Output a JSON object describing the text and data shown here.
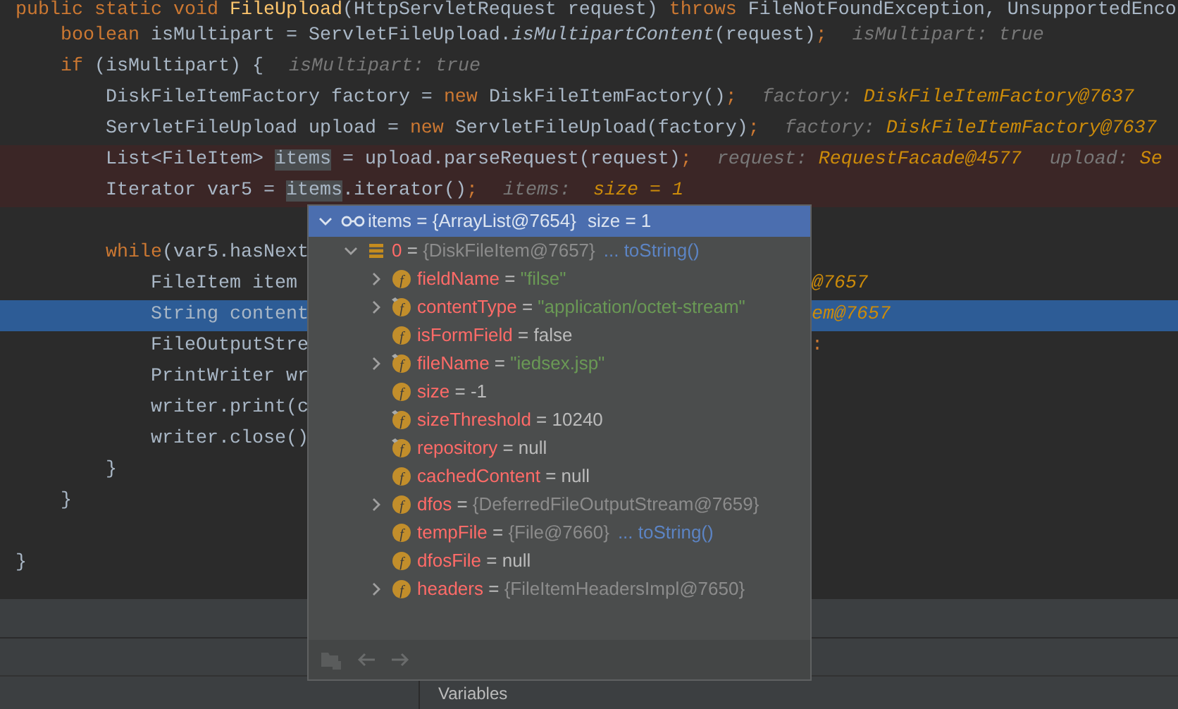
{
  "editor": {
    "lines": [
      {
        "kind": "code",
        "breakpoint": false,
        "selected": false,
        "code": [
          {
            "kind": "kw",
            "text": "public static void "
          },
          {
            "kind": "decl",
            "text": "FileUpload"
          },
          {
            "kind": "p",
            "text": "(HttpServletRequest request) "
          },
          {
            "kind": "kw",
            "text": "throws "
          },
          {
            "kind": "p",
            "text": "FileNotFoundException, UnsupportedEnco"
          }
        ]
      },
      {
        "kind": "code",
        "breakpoint": false,
        "selected": false,
        "code": [
          {
            "kind": "kw",
            "text": "    boolean "
          },
          {
            "kind": "p",
            "text": "isMultipart = ServletFileUpload."
          },
          {
            "kind": "it",
            "text": "isMultipartContent"
          },
          {
            "kind": "p",
            "text": "(request)"
          },
          {
            "kind": "kw",
            "text": ";"
          }
        ],
        "hints": [
          [
            {
              "kind": "hint",
              "text": "isMultipart: true"
            }
          ]
        ]
      },
      {
        "kind": "code",
        "breakpoint": false,
        "selected": false,
        "code": [
          {
            "kind": "kw",
            "text": "    if "
          },
          {
            "kind": "p",
            "text": "(isMultipart) {"
          }
        ],
        "hints": [
          [
            {
              "kind": "hint",
              "text": "isMultipart: true"
            }
          ]
        ]
      },
      {
        "kind": "code",
        "breakpoint": false,
        "selected": false,
        "code": [
          {
            "kind": "p",
            "text": "        DiskFileItemFactory factory = "
          },
          {
            "kind": "kw",
            "text": "new "
          },
          {
            "kind": "p",
            "text": "DiskFileItemFactory()"
          },
          {
            "kind": "kw",
            "text": ";"
          }
        ],
        "hints": [
          [
            {
              "kind": "hint",
              "text": "factory: "
            },
            {
              "kind": "val",
              "text": "DiskFileItemFactory@7637"
            }
          ]
        ]
      },
      {
        "kind": "code",
        "breakpoint": false,
        "selected": false,
        "code": [
          {
            "kind": "p",
            "text": "        ServletFileUpload upload = "
          },
          {
            "kind": "kw",
            "text": "new "
          },
          {
            "kind": "p",
            "text": "ServletFileUpload(factory)"
          },
          {
            "kind": "kw",
            "text": ";"
          }
        ],
        "hints": [
          [
            {
              "kind": "hint",
              "text": "factory: "
            },
            {
              "kind": "val",
              "text": "DiskFileItemFactory@7637"
            }
          ]
        ]
      },
      {
        "kind": "code",
        "breakpoint": true,
        "selected": false,
        "code": [
          {
            "kind": "p",
            "text": "        List<FileItem> "
          },
          {
            "kind": "tok",
            "text": "items"
          },
          {
            "kind": "p",
            "text": " = upload.parseRequest(request)"
          },
          {
            "kind": "kw",
            "text": ";"
          }
        ],
        "hints": [
          [
            {
              "kind": "hint",
              "text": "request: "
            },
            {
              "kind": "val",
              "text": "RequestFacade@4577"
            }
          ],
          [
            {
              "kind": "hint",
              "text": "upload: "
            },
            {
              "kind": "val",
              "text": "Se"
            }
          ]
        ]
      },
      {
        "kind": "code",
        "breakpoint": true,
        "selected": false,
        "code": [
          {
            "kind": "p",
            "text": "        Iterator var5 = "
          },
          {
            "kind": "tok",
            "text": "items"
          },
          {
            "kind": "p",
            "text": ".iterator()"
          },
          {
            "kind": "kw",
            "text": ";"
          }
        ],
        "hints": [
          [
            {
              "kind": "hint",
              "text": "items:  "
            },
            {
              "kind": "val",
              "text": "size = 1"
            }
          ]
        ]
      },
      {
        "kind": "blank"
      },
      {
        "kind": "code",
        "breakpoint": false,
        "selected": false,
        "code": [
          {
            "kind": "kw",
            "text": "        while"
          },
          {
            "kind": "p",
            "text": "(var5.hasNext"
          }
        ]
      },
      {
        "kind": "code",
        "breakpoint": false,
        "selected": false,
        "code": [
          {
            "kind": "p",
            "text": "            FileItem item"
          }
        ],
        "right": [
          {
            "kind": "val",
            "text": "@7657"
          }
        ]
      },
      {
        "kind": "code",
        "breakpoint": false,
        "selected": true,
        "code": [
          {
            "kind": "p",
            "text": "            String content"
          }
        ],
        "right": [
          {
            "kind": "val",
            "text": "em@7657"
          }
        ]
      },
      {
        "kind": "code",
        "breakpoint": false,
        "selected": false,
        "code": [
          {
            "kind": "p",
            "text": "            FileOutputStre"
          }
        ],
        "right": [
          {
            "kind": "kw",
            "text": ":"
          }
        ]
      },
      {
        "kind": "code",
        "breakpoint": false,
        "selected": false,
        "code": [
          {
            "kind": "p",
            "text": "            PrintWriter wr"
          }
        ]
      },
      {
        "kind": "code",
        "breakpoint": false,
        "selected": false,
        "code": [
          {
            "kind": "p",
            "text": "            writer.print(c"
          }
        ]
      },
      {
        "kind": "code",
        "breakpoint": false,
        "selected": false,
        "code": [
          {
            "kind": "p",
            "text": "            writer.close()"
          }
        ]
      },
      {
        "kind": "code",
        "breakpoint": false,
        "selected": false,
        "code": [
          {
            "kind": "p",
            "text": "        }"
          }
        ]
      },
      {
        "kind": "code",
        "breakpoint": false,
        "selected": false,
        "code": [
          {
            "kind": "p",
            "text": "    }"
          }
        ]
      },
      {
        "kind": "blank"
      },
      {
        "kind": "code",
        "breakpoint": false,
        "selected": false,
        "code": [
          {
            "kind": "p",
            "text": "}"
          }
        ]
      }
    ]
  },
  "popup": {
    "root": {
      "name": "items",
      "operator": "=",
      "value": "{ArrayList@7654}",
      "extra": "size = 1",
      "expanded": true,
      "selected": true,
      "children": [
        {
          "name": "0",
          "operator": "=",
          "value": "{DiskFileItem@7657}",
          "link": "... toString()",
          "expanded": true,
          "selected": false,
          "children": [
            {
              "icon": "f",
              "name": "fieldName",
              "operator": "=",
              "value": "\"filse\"",
              "kind": "string",
              "expanded": false,
              "marked": false,
              "selected": false
            },
            {
              "icon": "f",
              "name": "contentType",
              "operator": "=",
              "value": "\"application/octet-stream\"",
              "kind": "string",
              "expanded": false,
              "marked": true,
              "selected": false
            },
            {
              "icon": "f",
              "name": "isFormField",
              "operator": "=",
              "value": "false",
              "kind": "primitive",
              "marked": false,
              "selected": false
            },
            {
              "icon": "f",
              "name": "fileName",
              "operator": "=",
              "value": "\"iedsex.jsp\"",
              "kind": "string",
              "expanded": false,
              "marked": true,
              "selected": false
            },
            {
              "icon": "f",
              "name": "size",
              "operator": "=",
              "value": "-1",
              "kind": "primitive",
              "marked": false,
              "selected": false
            },
            {
              "icon": "f",
              "name": "sizeThreshold",
              "operator": "=",
              "value": "10240",
              "kind": "primitive",
              "marked": true,
              "selected": false
            },
            {
              "icon": "f",
              "name": "repository",
              "operator": "=",
              "value": "null",
              "kind": "primitive",
              "marked": true,
              "selected": false
            },
            {
              "icon": "f",
              "name": "cachedContent",
              "operator": "=",
              "value": "null",
              "kind": "primitive",
              "marked": false,
              "selected": false
            },
            {
              "icon": "f",
              "name": "dfos",
              "operator": "=",
              "value": "{DeferredFileOutputStream@7659}",
              "kind": "ref",
              "expanded": false,
              "marked": false,
              "selected": false
            },
            {
              "icon": "f",
              "name": "tempFile",
              "operator": "=",
              "value": "{File@7660}",
              "kind": "ref",
              "link": "... toString()",
              "marked": false,
              "selected": false
            },
            {
              "icon": "f",
              "name": "dfosFile",
              "operator": "=",
              "value": "null",
              "kind": "primitive",
              "marked": false,
              "selected": false
            },
            {
              "icon": "f",
              "name": "headers",
              "operator": "=",
              "value": "{FileItemHeadersImpl@7650}",
              "kind": "ref",
              "expanded": false,
              "marked": false,
              "selected": false
            }
          ]
        }
      ]
    }
  },
  "bottom_panel": {
    "tab": "Variables"
  }
}
